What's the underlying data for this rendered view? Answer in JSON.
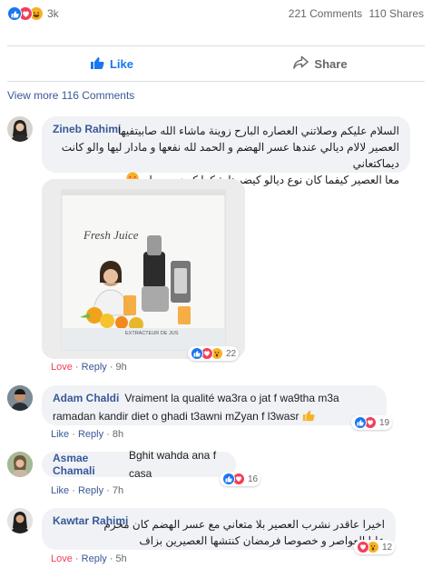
{
  "top": {
    "reactions_count": "3k",
    "comments": "221 Comments",
    "shares": "110 Shares"
  },
  "actions": {
    "like": "Like",
    "share": "Share"
  },
  "view_more": "View more 116 Comments",
  "comments": [
    {
      "author": "Zineb Rahimi",
      "lines": [
        "السلام عليكم وصلاتني العصاره البارح زوينة ماشاء الله صابيتفيها",
        "العصير لالام ديالي عندها عسر الهضم و الحمد لله نفعها و مادار ليها والو كانت ديماكتعاني",
        "معا العصير كيفما كان نوع ديالو كيضرها شكرا كويزين مول"
      ],
      "love": "Love",
      "reply": "Reply",
      "time": "9h",
      "reaction_count": "22",
      "photo_caption": "EXTRACTEUR DE JUS",
      "photo_brand": "Fresh Juice"
    },
    {
      "author": "Adam Chaldi",
      "lines": [
        "Vraiment la qualité wa3ra o jat f wa9tha m3a",
        "ramadan kandir diet o ghadi t3awni mZyan f l3wasr"
      ],
      "like": "Like",
      "reply": "Reply",
      "time": "8h",
      "reaction_count": "19"
    },
    {
      "author": "Asmae Chamali",
      "lines": [
        "Bghit wahda ana f casa"
      ],
      "like": "Like",
      "reply": "Reply",
      "time": "7h",
      "reaction_count": "16"
    },
    {
      "author": "Kawtar Rahimi",
      "lines": [
        "اخيرا عاقدر نشرب العصير بلا متعاني مع عسر الهضم كان محرم",
        "عليا العواصر و خصوصا فرمضان كنتشها العصيرين بزاف"
      ],
      "love": "Love",
      "reply": "Reply",
      "time": "5h",
      "reaction_count": "12"
    }
  ],
  "colors": {
    "facebook_blue": "#1877f2",
    "link_blue": "#385898",
    "love_red": "#f33e58",
    "gray_text": "#65676b"
  }
}
